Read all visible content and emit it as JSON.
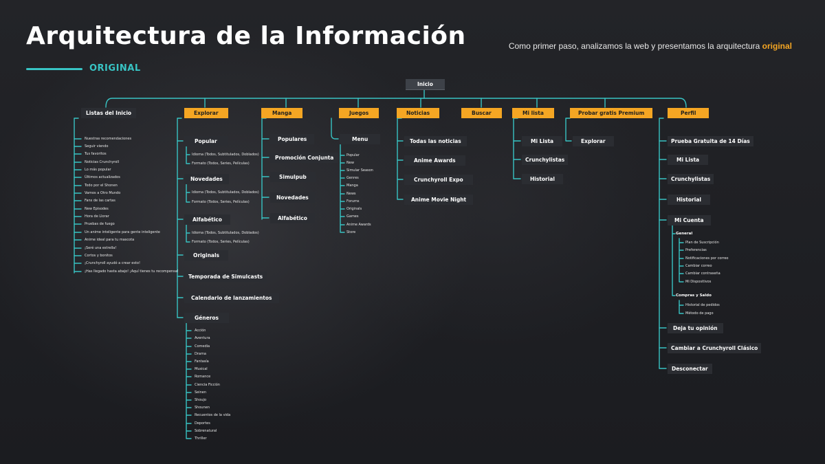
{
  "header": {
    "title": "Arquitectura de la Información",
    "tag": "ORIGINAL",
    "subtitle_prefix": "Como primer paso, analizamos la web y presentamos la arquitectura ",
    "subtitle_accent": "original"
  },
  "colors": {
    "accent_teal": "#38c4c4",
    "accent_orange": "#f5a623",
    "background": "#1f2024"
  },
  "tree": {
    "root": "Inicio",
    "categories": {
      "listas": "Listas del Inicio",
      "explorar": "Explorar",
      "manga": "Manga",
      "juegos": "Juegos",
      "noticias": "Noticias",
      "buscar": "Buscar",
      "milista": "Mi lista",
      "probar": "Probar gratis Premium",
      "perfil": "Perfil"
    },
    "listas_items": [
      "Nuestras recomendaciones",
      "Seguir viendo",
      "Tus favoritos",
      "Noticias Crunchyroll",
      "Lo más popular",
      "Últimos actualizados",
      "Todo por el Shonen",
      "Vamos a Otro Mundo",
      "Fans de las cartas",
      "New Episodes",
      "Hora de Llorar",
      "Pruebas de fuego",
      "Un anime inteligente para gente inteligente",
      "Anime ideal para tu mascota",
      "¡Seré una estrella!",
      "Cortos y bonitos",
      "¡Crunchyroll ayudó a crear esto!",
      "¡Has llegado hasta abajo! ¡Aquí tienes tu recompensa!"
    ],
    "explorar": {
      "popular": "Popular",
      "popular_items": [
        "Idioma (Todos, Subtitulados, Doblados)",
        "Formato (Todos, Series, Películas)"
      ],
      "novedades": "Novedades",
      "novedades_items": [
        "Idioma (Todos, Subtitulados, Doblados)",
        "Formato (Todos, Series, Películas)"
      ],
      "alfabetico": "Alfabético",
      "alfabetico_items": [
        "Idioma (Todos, Subtitulados, Doblados)",
        "Formato (Todos, Series, Películas)"
      ],
      "originals": "Originals",
      "temporada": "Temporada de Simulcasts",
      "calendario": "Calendario de lanzamientos",
      "generos": "Géneros",
      "generos_items": [
        "Acción",
        "Aventura",
        "Comedia",
        "Drama",
        "Fantasía",
        "Musical",
        "Romance",
        "Ciencia Ficción",
        "Seinen",
        "Shoujo",
        "Shounen",
        "Recuentos de la vida",
        "Deportes",
        "Sobrenatural",
        "Thriller"
      ]
    },
    "manga_items": [
      "Populares",
      "Promoción Conjunta",
      "Simulpub",
      "Novedades",
      "Alfabético"
    ],
    "juegos": {
      "menu": "Menu",
      "menu_items": [
        "Popular",
        "New",
        "Simular Season",
        "Genres",
        "Manga",
        "News",
        "Forums",
        "Originals",
        "Games",
        "Anime Awards",
        "Store"
      ]
    },
    "noticias_items": [
      "Todas las noticias",
      "Anime Awards",
      "Crunchyroll Expo",
      "Anime Movie Night"
    ],
    "milista_items": [
      "Mi Lista",
      "Crunchylistas",
      "Historial"
    ],
    "probar_items": [
      "Explorar"
    ],
    "perfil": {
      "items_top": [
        "Prueba Gratuita de 14 Días",
        "Mi Lista",
        "Crunchylistas",
        "Historial",
        "Mi Cuenta"
      ],
      "general": "General",
      "general_items": [
        "Plan de Suscripción",
        "Preferencias",
        "Notificaciones por correo",
        "Cambiar correo",
        "Cambiar contraseña",
        "Mi Dispositivos"
      ],
      "compras": "Compras y Saldo",
      "compras_items": [
        "Historial de pedidos",
        "Método de pago"
      ],
      "items_bottom": [
        "Deja tu opinión",
        "Cambiar a Crunchyroll Clásico",
        "Desconectar"
      ]
    }
  }
}
